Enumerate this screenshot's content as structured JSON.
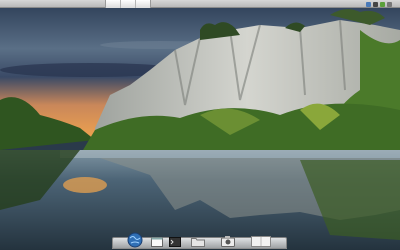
{
  "screen": {
    "desktop": {
      "wallpaper": "lake-cliffs-reflection"
    },
    "top_panel": {
      "workspace_tabs": [
        {
          "id": "ws-1"
        },
        {
          "id": "ws-2"
        },
        {
          "id": "ws-3"
        }
      ],
      "tray_icons": [
        "network-icon",
        "volume-icon",
        "chat-icon",
        "battery-icon"
      ],
      "clock_text": ""
    },
    "dock": {
      "items": [
        {
          "name": "globe-icon"
        },
        {
          "name": "window-icon"
        },
        {
          "name": "terminal-icon"
        },
        {
          "name": "folder-icon"
        },
        {
          "name": "camera-icon"
        },
        {
          "name": "trash-icon"
        }
      ]
    }
  },
  "colors": {
    "panel": "#c8c8c8",
    "dock": "#d9d9d9",
    "sky_top": "#3b4f66",
    "sunset": "#e89a4e",
    "water": "#3f5667",
    "cliff": "#bcbcb6",
    "foliage": "#3e6b2a"
  }
}
